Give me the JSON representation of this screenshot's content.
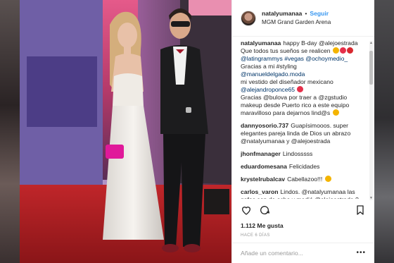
{
  "header": {
    "username": "natalyumanaa",
    "separator": "•",
    "follow_label": "Seguir",
    "location": "MGM Grand Garden Arena"
  },
  "comments": [
    {
      "user": "natalyumanaa",
      "lines": [
        "happy B-day @alejoestrada",
        "Que todos tus sueños se realicen",
        "@latingrammys #vegas @ochoymedio_",
        "Gracias a mi #styling",
        "@manueldelgado.moda",
        "mi vestido del diseñador mexicano",
        "@alejandroponce65",
        "Gracias @bulova por traer a @zgstudio",
        "makeup desde Puerto rico a este equipo",
        "maravilloso para dejarnos lind@s"
      ]
    },
    {
      "user": "dannyosorio.737",
      "text": "Guapísimooos. super elegantes pareja linda de Dios un abrazo @natalyumanaa y @alejoestrada"
    },
    {
      "user": "jhonfmanager",
      "text": "Lindosssss"
    },
    {
      "user": "eduardomesana",
      "text": "Felicidades"
    },
    {
      "user": "krystelrubalcav",
      "text": "Cabellazoo!!!"
    },
    {
      "user": "carlos_varon",
      "text": "Lindos. @natalyumanaa las gafas son de ocho y medió @alejoestrada ?"
    }
  ],
  "likes": "1.112 Me gusta",
  "time_ago": "HACE 6 DÍAS",
  "add_comment_placeholder": "Añade un comentario...",
  "more_label": "•••",
  "icons": [
    "heart-icon",
    "comment-icon",
    "bookmark-icon",
    "more-options-icon"
  ],
  "colors": {
    "link": "#003569",
    "follow": "#3897f0",
    "text": "#262626",
    "muted": "#999999"
  }
}
